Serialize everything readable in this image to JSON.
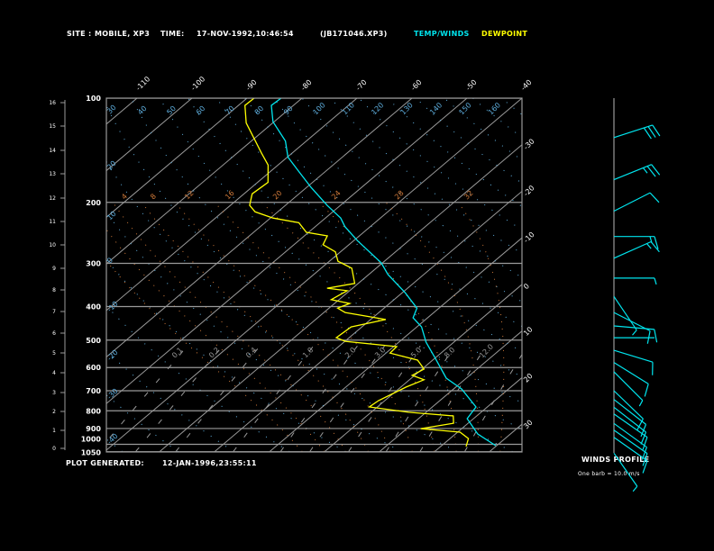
{
  "header": {
    "site_label": "SITE :",
    "site_value": "MOBILE, XP3",
    "time_label": "TIME:",
    "time_value": "17-NOV-1992,10:46:54",
    "file": "(JB171046.XP3)",
    "legend_temp": "TEMP/WINDS",
    "legend_dew": "DEWPOINT"
  },
  "footer": {
    "generated_label": "PLOT GENERATED:",
    "generated_value": "12-JAN-1996,23:55:11",
    "winds_title": "WINDS PROFILE",
    "winds_legend": "One barb = 10.0 m/s"
  },
  "colors": {
    "temp": "#00e5ee",
    "dewpoint": "#ffff00",
    "grid": "#9a9a9a",
    "dry_adiabat": "#5fb0e0",
    "moist_adiabat": "#d07a3a",
    "mixing_ratio": "#9a9a9a",
    "text": "#ffffff"
  },
  "chart_data": {
    "type": "line",
    "subtype": "skew-T log-p",
    "y_axis": {
      "quantity": "pressure (hPa)",
      "scale": "log",
      "range": [
        1050,
        100
      ],
      "ticks": [
        100,
        200,
        300,
        400,
        500,
        600,
        700,
        800,
        900,
        1000,
        1050
      ]
    },
    "height_axis": {
      "quantity": "height (km)",
      "ticks": [
        0,
        1,
        2,
        3,
        4,
        5,
        6,
        7,
        8,
        9,
        10,
        11,
        12,
        13,
        14,
        15,
        16
      ]
    },
    "isotherm_labels_top": [
      -110,
      -100,
      -90,
      -80,
      -70,
      -60,
      -50,
      -40
    ],
    "isotherm_labels_right": [
      -30,
      -20,
      -10,
      0,
      10,
      20,
      30
    ],
    "dry_adiabat_labels_top": [
      40,
      50,
      60,
      70,
      80,
      90,
      100,
      110,
      120,
      130,
      140,
      150,
      160
    ],
    "dry_adiabat_labels_left": [
      30,
      20,
      10,
      0,
      -10,
      -20,
      -30,
      -40
    ],
    "moist_adiabat_labels": [
      4,
      8,
      12,
      16,
      20,
      24,
      28,
      32
    ],
    "mixing_ratio_labels": [
      "0.1",
      "0.2",
      "0.4",
      "1.0",
      "2.0",
      "3.0",
      "5.0",
      "8.0",
      "12.0"
    ],
    "grid": true,
    "series": [
      {
        "name": "TEMP/WINDS",
        "color": "#00e5ee",
        "points": [
          [
            100,
            -83.8
          ],
          [
            105,
            -84.0
          ],
          [
            117,
            -80.2
          ],
          [
            133,
            -73.8
          ],
          [
            148,
            -69.9
          ],
          [
            162,
            -65.1
          ],
          [
            181,
            -59.2
          ],
          [
            204,
            -52.4
          ],
          [
            222,
            -47.2
          ],
          [
            235,
            -44.6
          ],
          [
            258,
            -39.3
          ],
          [
            299,
            -30.2
          ],
          [
            323,
            -26.5
          ],
          [
            365,
            -19.4
          ],
          [
            404,
            -14.0
          ],
          [
            431,
            -12.6
          ],
          [
            458,
            -9.1
          ],
          [
            507,
            -5.0
          ],
          [
            565,
            0.2
          ],
          [
            644,
            6.4
          ],
          [
            692,
            11.5
          ],
          [
            780,
            18.0
          ],
          [
            843,
            18.9
          ],
          [
            933,
            24.1
          ],
          [
            1009,
            29.9
          ]
        ]
      },
      {
        "name": "DEWPOINT",
        "color": "#ffff00",
        "points": [
          [
            100,
            -88.7
          ],
          [
            105,
            -88.8
          ],
          [
            118,
            -84.8
          ],
          [
            132,
            -79.6
          ],
          [
            144,
            -75.6
          ],
          [
            156,
            -71.8
          ],
          [
            175,
            -68.1
          ],
          [
            189,
            -68.5
          ],
          [
            204,
            -66.5
          ],
          [
            213,
            -64.1
          ],
          [
            222,
            -59.5
          ],
          [
            229,
            -53.8
          ],
          [
            244,
            -50.4
          ],
          [
            250,
            -45.8
          ],
          [
            265,
            -44.7
          ],
          [
            278,
            -40.9
          ],
          [
            296,
            -38.4
          ],
          [
            310,
            -34.4
          ],
          [
            343,
            -30.6
          ],
          [
            354,
            -34.6
          ],
          [
            360,
            -30.4
          ],
          [
            382,
            -31.4
          ],
          [
            392,
            -27.2
          ],
          [
            404,
            -28.4
          ],
          [
            416,
            -26.1
          ],
          [
            436,
            -17.2
          ],
          [
            458,
            -21.9
          ],
          [
            492,
            -22.3
          ],
          [
            504,
            -19.9
          ],
          [
            522,
            -9.4
          ],
          [
            545,
            -9.2
          ],
          [
            571,
            -2.7
          ],
          [
            606,
            0.4
          ],
          [
            632,
            -0.4
          ],
          [
            651,
            2.7
          ],
          [
            683,
            1.0
          ],
          [
            748,
            -1.1
          ],
          [
            780,
            -1.4
          ],
          [
            808,
            6.9
          ],
          [
            828,
            15.8
          ],
          [
            869,
            17.4
          ],
          [
            901,
            12.6
          ],
          [
            922,
            20.5
          ],
          [
            962,
            23.4
          ],
          [
            1015,
            24.7
          ]
        ]
      }
    ],
    "winds": {
      "units": "m/s",
      "barbs": [
        {
          "p": 130,
          "dir": 72,
          "spd": 30
        },
        {
          "p": 172,
          "dir": 68,
          "spd": 25
        },
        {
          "p": 212,
          "dir": 63,
          "spd": 10
        },
        {
          "p": 251,
          "dir": 90,
          "spd": 15
        },
        {
          "p": 290,
          "dir": 66,
          "spd": 15
        },
        {
          "p": 331,
          "dir": 90,
          "spd": 5
        },
        {
          "p": 374,
          "dir": 146,
          "spd": 5
        },
        {
          "p": 416,
          "dir": 117,
          "spd": 10
        },
        {
          "p": 455,
          "dir": 95,
          "spd": 10
        },
        {
          "p": 492,
          "dir": 90,
          "spd": 0
        },
        {
          "p": 535,
          "dir": 107,
          "spd": 10
        },
        {
          "p": 580,
          "dir": 122,
          "spd": 10
        },
        {
          "p": 617,
          "dir": 135,
          "spd": 5
        },
        {
          "p": 700,
          "dir": 134,
          "spd": 10
        },
        {
          "p": 742,
          "dir": 128,
          "spd": 10
        },
        {
          "p": 781,
          "dir": 128,
          "spd": 10
        },
        {
          "p": 817,
          "dir": 125,
          "spd": 10
        },
        {
          "p": 870,
          "dir": 126,
          "spd": 10
        },
        {
          "p": 910,
          "dir": 125,
          "spd": 10
        },
        {
          "p": 955,
          "dir": 125,
          "spd": 10
        },
        {
          "p": 1060,
          "dir": 145,
          "spd": 5
        }
      ]
    }
  }
}
